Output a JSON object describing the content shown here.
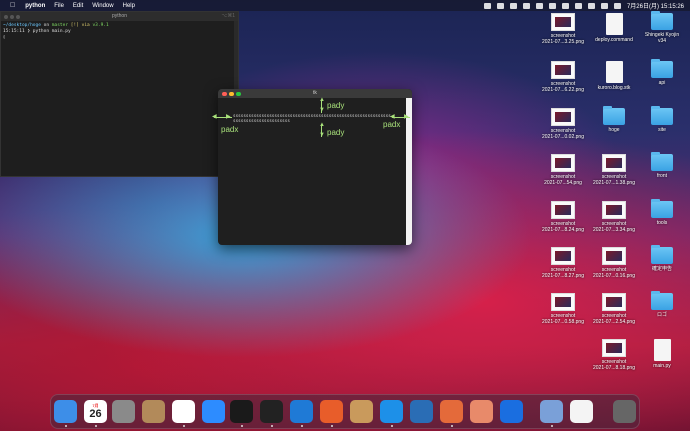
{
  "menubar": {
    "apple": "",
    "app_name": "python",
    "items": [
      "File",
      "Edit",
      "Window",
      "Help"
    ],
    "clock": "7月26日(月)  15:15:26"
  },
  "terminal": {
    "title": "python",
    "shortcut": "⌥⌘1",
    "line1_path": "~/desktop/hoge",
    "line1_on": "on",
    "line1_branch": "master",
    "line1_rest": "[!] via",
    "line1_version": "v3.9.1",
    "line2": "15:15:11 ❯ python main.py",
    "cursor": "▯"
  },
  "tk_window": {
    "title": "tk",
    "label_text": "sssssssssssssssssssssssssssssssssssssssssssssssssssssssssssssssssssssssssssssssssss",
    "pady_label": "pady",
    "padx_label": "padx"
  },
  "desktop_icons": [
    {
      "label": "screenshot\n2021-07...3.25.png",
      "kind": "shot"
    },
    {
      "label": "deploy.command",
      "kind": "doc"
    },
    {
      "label": "Shingeki Kyojin\nv34",
      "kind": "folder"
    },
    {
      "label": "screenshot\n2021-07...6.22.png",
      "kind": "shot"
    },
    {
      "label": "kuroro.blog.stk",
      "kind": "doc"
    },
    {
      "label": "api",
      "kind": "folder"
    },
    {
      "label": "screenshot\n2021-07...0.02.png",
      "kind": "shot"
    },
    {
      "label": "hoge",
      "kind": "folder"
    },
    {
      "label": "site",
      "kind": "folder"
    },
    {
      "label": "screenshot\n2021-07...54.png",
      "kind": "shot"
    },
    {
      "label": "screenshot\n2021-07...1.38.png",
      "kind": "shot"
    },
    {
      "label": "front",
      "kind": "folder"
    },
    {
      "label": "screenshot\n2021-07...8.24.png",
      "kind": "shot"
    },
    {
      "label": "screenshot\n2021-07...3.34.png",
      "kind": "shot"
    },
    {
      "label": "tools",
      "kind": "folder"
    },
    {
      "label": "screenshot\n2021-07...8.27.png",
      "kind": "shot"
    },
    {
      "label": "screenshot\n2021-07...0.16.png",
      "kind": "shot"
    },
    {
      "label": "確定申告",
      "kind": "folder"
    },
    {
      "label": "screenshot\n2021-07...0.58.png",
      "kind": "shot"
    },
    {
      "label": "screenshot\n2021-07...2.54.png",
      "kind": "shot"
    },
    {
      "label": "ロゴ",
      "kind": "folder"
    },
    {
      "label": "screenshot\n2021-07...8.18.png",
      "kind": "shot"
    },
    {
      "label": "main.py",
      "kind": "doc"
    }
  ],
  "dock": {
    "calendar_day": "26",
    "calendar_month": "7月",
    "apps": [
      "finder-icon",
      "calendar-icon",
      "system-preferences-icon",
      "contacts-icon",
      "chrome-icon",
      "zoom-icon",
      "activity-monitor-icon",
      "terminal-icon",
      "vscode-icon",
      "analytics-icon",
      "archive-utility-icon",
      "docker-icon",
      "quicktime-icon",
      "sourcetree-icon",
      "photo-app-icon",
      "infinity-app-icon",
      "preview-icon",
      "document-icon",
      "trash-icon"
    ]
  }
}
